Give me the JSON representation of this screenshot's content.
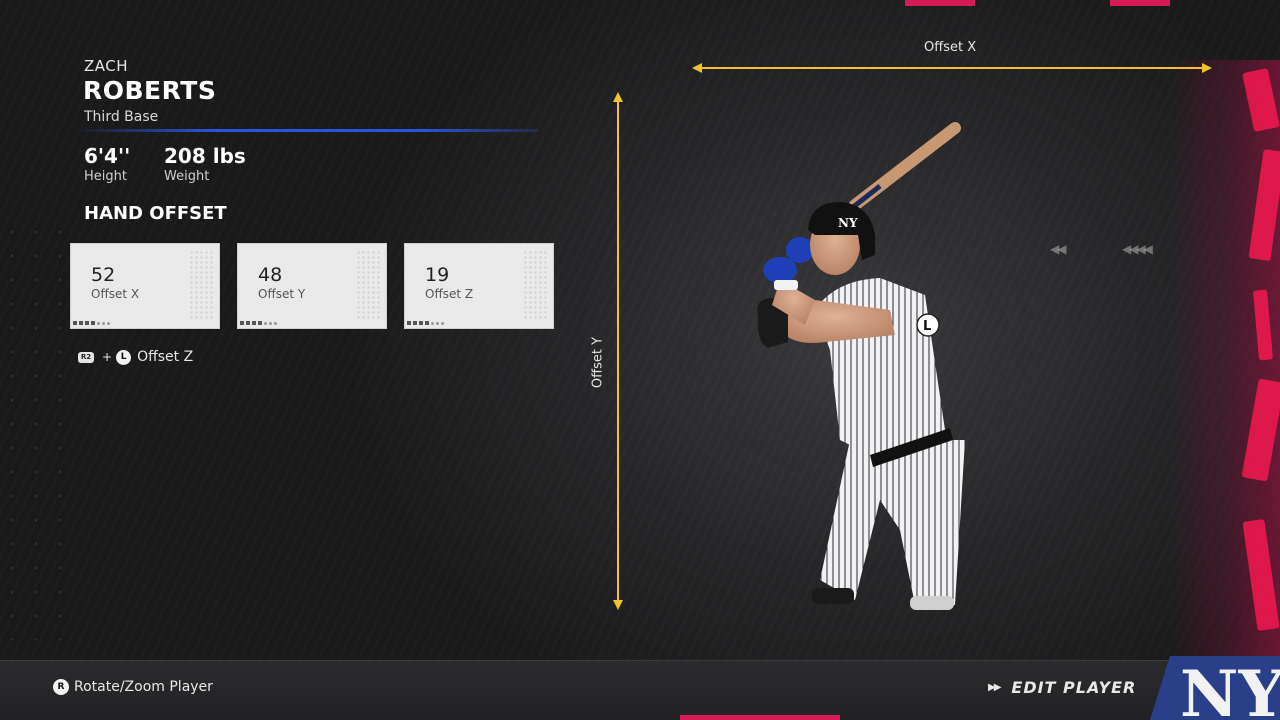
{
  "player": {
    "first_name": "ZACH",
    "last_name": "ROBERTS",
    "position": "Third Base",
    "height_value": "6'4''",
    "height_label": "Height",
    "weight_value": "208 lbs",
    "weight_label": "Weight"
  },
  "hand_offset": {
    "title": "HAND OFFSET",
    "cards": [
      {
        "value": "52",
        "label": "Offset X",
        "level_pips": 4
      },
      {
        "value": "48",
        "label": "Offset Y",
        "level_pips": 4
      },
      {
        "value": "19",
        "label": "Offset Z",
        "level_pips": 4
      }
    ],
    "hint": {
      "button_a": "R2",
      "plus": "+",
      "button_b": "L",
      "label": "Offset Z"
    }
  },
  "axes": {
    "x_label": "Offset X",
    "y_label": "Offset Y",
    "color": "#f1c232"
  },
  "figure": {
    "stick_marker": "L"
  },
  "footer": {
    "rotate_button": "R",
    "rotate_label": "Rotate/Zoom Player",
    "edit_label": "EDIT PLAYER"
  },
  "colors": {
    "accent_blue": "#2a55d8",
    "accent_pink": "#e8184e",
    "axis_yellow": "#f1c232"
  }
}
